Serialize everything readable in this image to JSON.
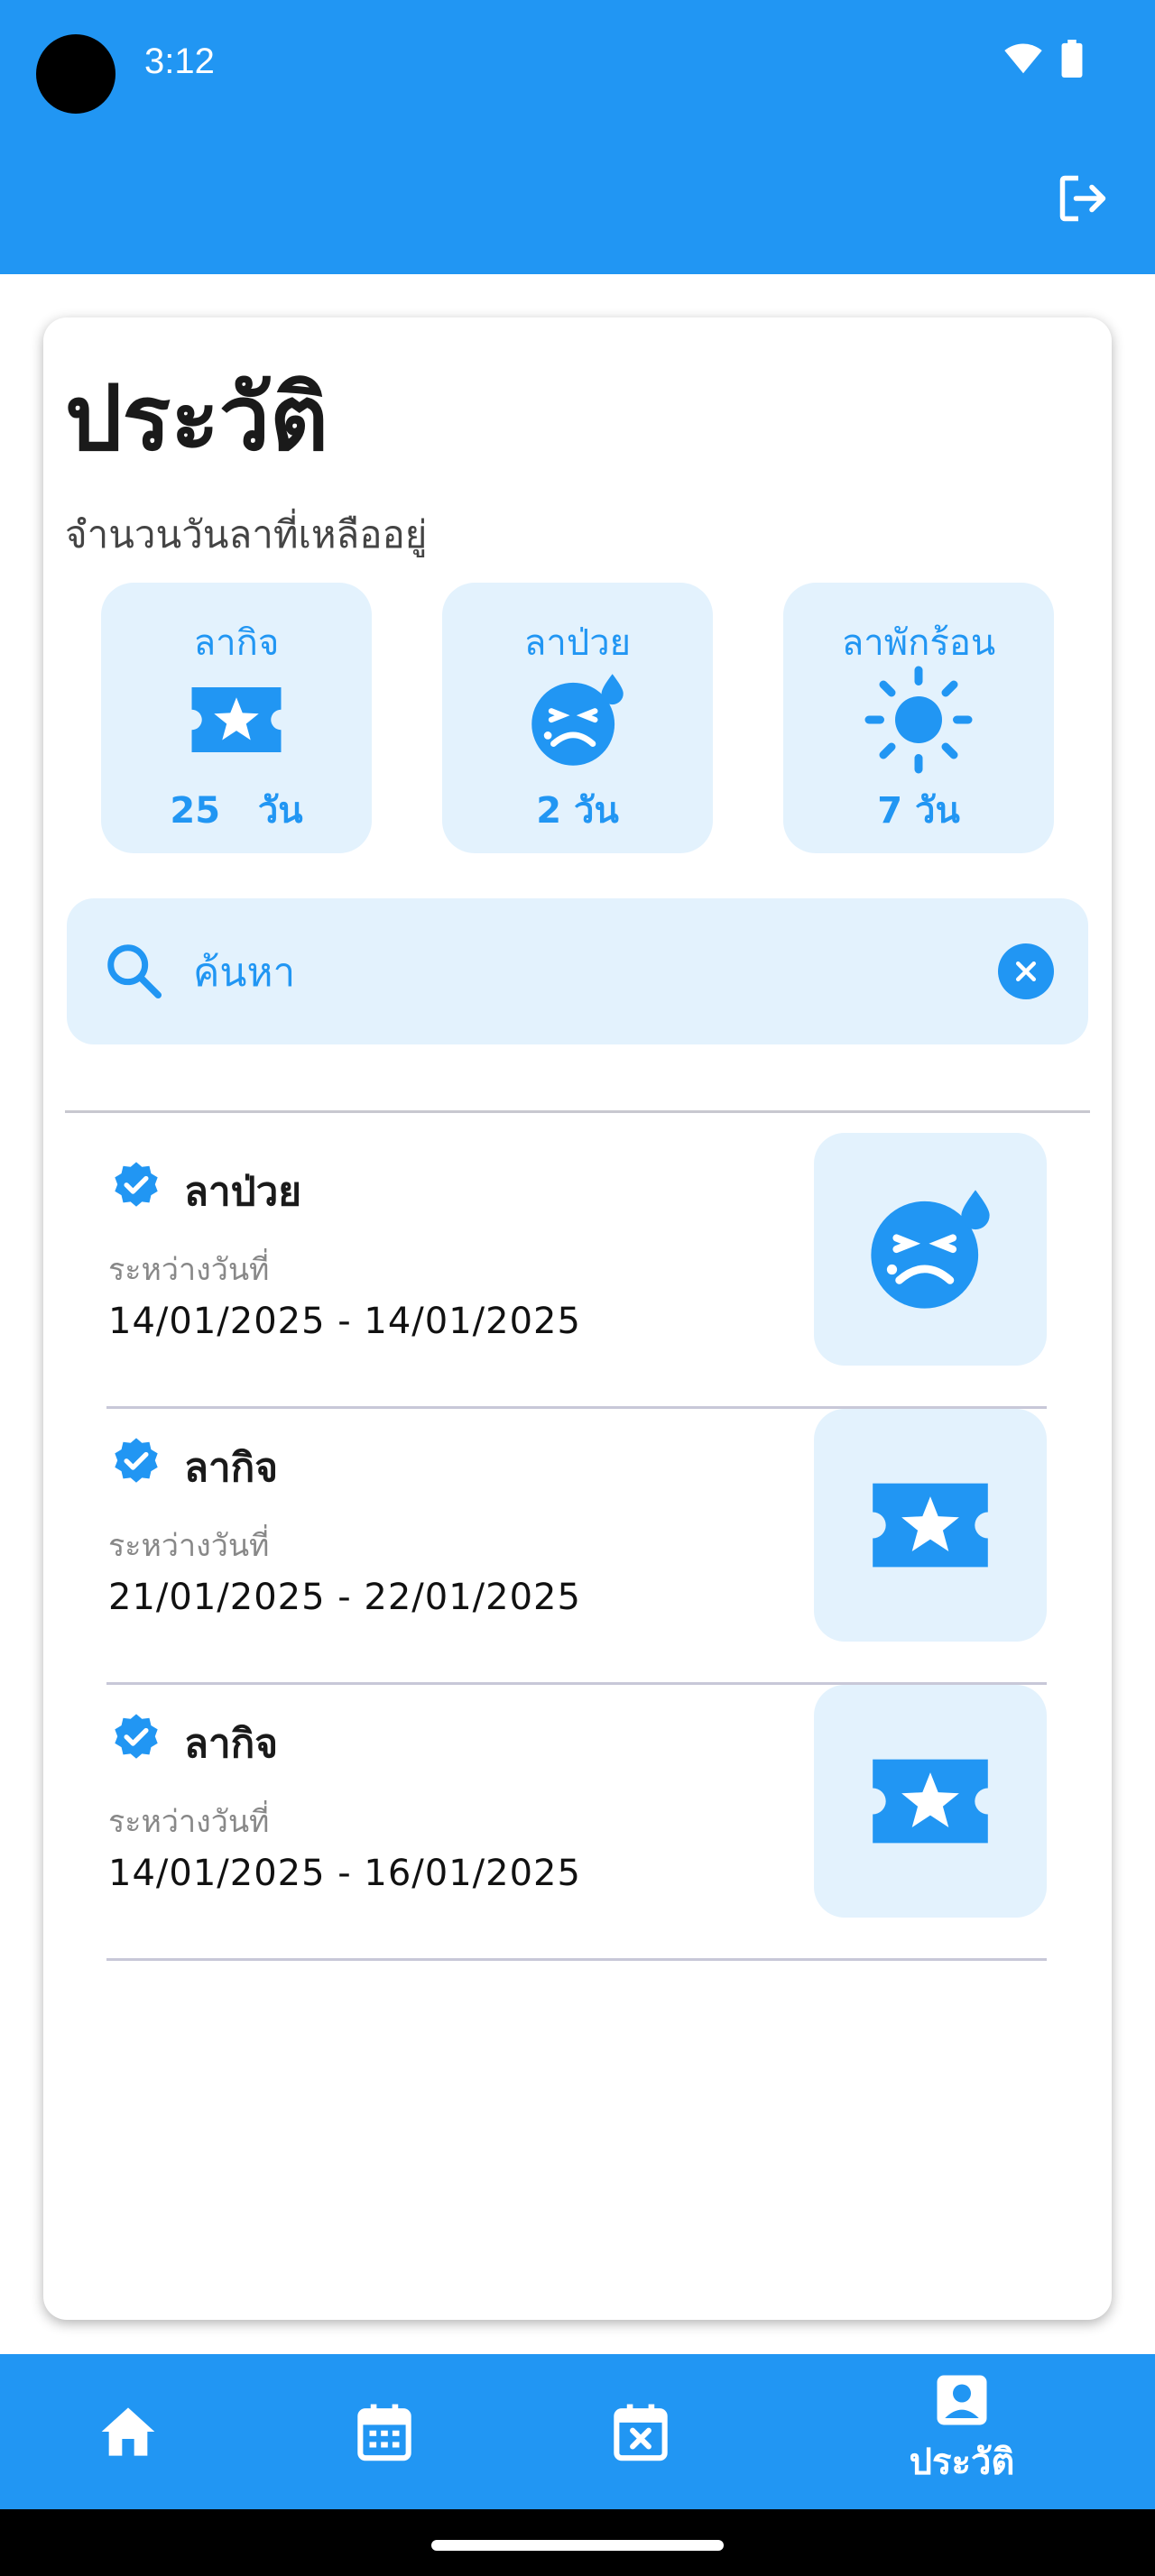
{
  "status_bar": {
    "time": "3:12"
  },
  "header": {
    "title": "ประวัติ",
    "subtitle": "จำนวนวันลาที่เหลืออยู่"
  },
  "stats": [
    {
      "label": "ลากิจ",
      "value": "25   วัน",
      "icon": "ticket-star-icon"
    },
    {
      "label": "ลาป่วย",
      "value": "2 วัน",
      "icon": "sick-face-icon"
    },
    {
      "label": "ลาพักร้อน",
      "value": "7 วัน",
      "icon": "sun-icon"
    }
  ],
  "search": {
    "placeholder": "ค้นหา",
    "value": ""
  },
  "history": [
    {
      "type": "ลาป่วย",
      "between_label": "ระหว่างวันที่",
      "dates": "14/01/2025 - 14/01/2025",
      "icon": "sick-face-icon"
    },
    {
      "type": "ลากิจ",
      "between_label": "ระหว่างวันที่",
      "dates": "21/01/2025 - 22/01/2025",
      "icon": "ticket-star-icon"
    },
    {
      "type": "ลากิจ",
      "between_label": "ระหว่างวันที่",
      "dates": "14/01/2025 - 16/01/2025",
      "icon": "ticket-star-icon"
    }
  ],
  "bottom_nav": {
    "items": [
      {
        "icon": "home-icon",
        "label": ""
      },
      {
        "icon": "calendar-icon",
        "label": ""
      },
      {
        "icon": "calendar-x-icon",
        "label": ""
      },
      {
        "icon": "account-box-icon",
        "label": "ประวัติ"
      }
    ],
    "active_index": 3
  },
  "colors": {
    "primary": "#2196f3",
    "light": "#e3f2fd",
    "text": "#1a1a1a"
  }
}
